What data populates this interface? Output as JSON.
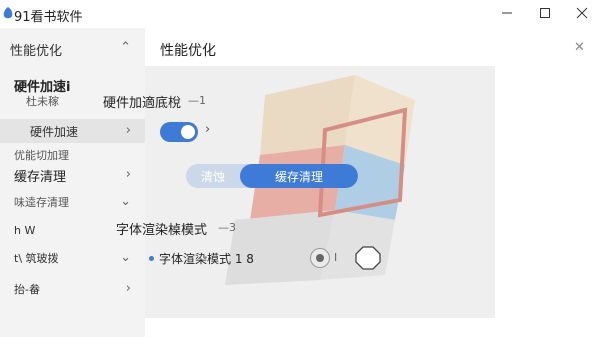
{
  "window": {
    "title": "91看书软件",
    "logo_icon": "app-logo-icon",
    "controls": [
      "minimize-icon",
      "maximize-icon",
      "close-icon"
    ]
  },
  "sidebar": {
    "header": {
      "label": "性能优化",
      "icon": "chevron-up-icon"
    },
    "group_title": "硬件加速i",
    "group_subtitle": "杜未稼",
    "items": [
      {
        "label": "硬件加速",
        "icon": "chevron-right-icon",
        "selected": true
      },
      {
        "label": "优能切加理",
        "icon": ""
      },
      {
        "label": "缓存清理",
        "icon": "chevron-right-icon"
      },
      {
        "label": "味逵存清理",
        "icon": "chevron-down-icon"
      },
      {
        "label": "h  W",
        "icon": ""
      },
      {
        "label": "t\\ 筑玻拨",
        "icon": "chevron-down-icon"
      },
      {
        "label": "抬-畚",
        "icon": "chevron-right-icon"
      }
    ]
  },
  "main": {
    "title": "性能优化",
    "close_icon": "close-icon",
    "hardware": {
      "title": "硬件加適底梲",
      "mark": "—1",
      "toggle_on": true,
      "arrow_icon": "chevron-right-icon"
    },
    "segment": {
      "options": [
        "清蚀",
        "缓存清理"
      ],
      "selected_index": 1
    },
    "font_render": {
      "title": "字体渲染槕模式",
      "mark": "—3",
      "option_label": "字体渲染模式 1 8",
      "radio_trailing": "I"
    },
    "colors": {
      "accent": "#3d7bd6",
      "sidebar_bg": "#f3f3f3",
      "card_bg": "#efefef"
    }
  }
}
